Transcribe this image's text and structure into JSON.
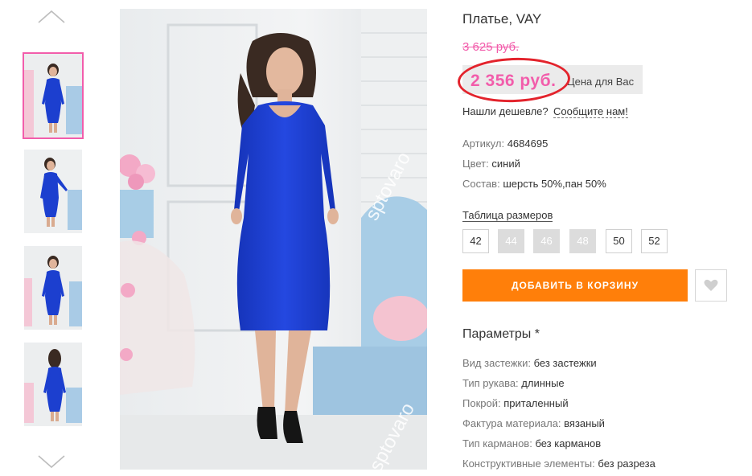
{
  "thumbnails": {
    "up_icon": "chevron-up-icon",
    "down_icon": "chevron-down-icon",
    "items": [
      {
        "label": "thumb-front",
        "active": true
      },
      {
        "label": "thumb-side",
        "active": false
      },
      {
        "label": "thumb-front-2",
        "active": false
      },
      {
        "label": "thumb-back",
        "active": false
      }
    ]
  },
  "photo": {
    "watermark": "sptovaro",
    "dress_color": "#1c3fcf",
    "accent": "#f25dab"
  },
  "product": {
    "title": "Платье, VAY",
    "old_price": "3 625 руб.",
    "price": "2 356 руб.",
    "price_note": "Цена для Вас",
    "cheaper_q": "Нашли дешевле?",
    "cheaper_link": "Сообщите нам!",
    "props": [
      {
        "k": "Артикул:",
        "v": "4684695"
      },
      {
        "k": "Цвет:",
        "v": "синий"
      },
      {
        "k": "Состав:",
        "v": "шерсть 50%,пан 50%"
      }
    ],
    "size_table": "Таблица размеров",
    "sizes": [
      {
        "label": "42",
        "available": true
      },
      {
        "label": "44",
        "available": false
      },
      {
        "label": "46",
        "available": false
      },
      {
        "label": "48",
        "available": false
      },
      {
        "label": "50",
        "available": true
      },
      {
        "label": "52",
        "available": true
      }
    ],
    "add_to_cart": "ДОБАВИТЬ В КОРЗИНУ",
    "wishlist_icon": "heart-icon",
    "params_title": "Параметры *",
    "params": [
      {
        "k": "Вид застежки:",
        "v": "без застежки"
      },
      {
        "k": "Тип рукава:",
        "v": "длинные"
      },
      {
        "k": "Покрой:",
        "v": "приталенный"
      },
      {
        "k": "Фактура материала:",
        "v": "вязаный"
      },
      {
        "k": "Тип карманов:",
        "v": "без карманов"
      },
      {
        "k": "Конструктивные элементы:",
        "v": "без разреза"
      }
    ]
  },
  "colors": {
    "accent_pink": "#f25dab",
    "cart_orange": "#ff7f0a",
    "annotation_red": "#e3232c"
  }
}
